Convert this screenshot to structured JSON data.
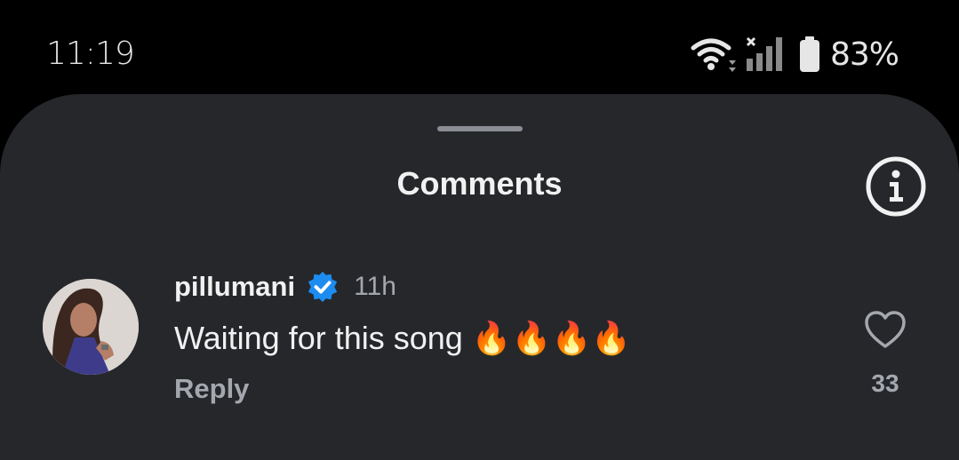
{
  "status_bar": {
    "time": "11:19",
    "battery_percent": "83%"
  },
  "sheet": {
    "title": "Comments"
  },
  "comments": [
    {
      "username": "pillumani",
      "verified": true,
      "time_ago": "11h",
      "text": "Waiting for this song 🔥🔥🔥🔥",
      "reply_label": "Reply",
      "like_count": "33"
    }
  ],
  "colors": {
    "background": "#000000",
    "sheet": "#25272b",
    "text_primary": "#f1f1f1",
    "text_secondary": "#a4a7ad",
    "verified_badge": "#1d8cf0"
  },
  "icons": {
    "wifi": "wifi-icon",
    "signal": "signal-icon",
    "battery": "battery-icon",
    "info": "info-icon",
    "verified": "verified-badge-icon",
    "like": "heart-icon"
  }
}
